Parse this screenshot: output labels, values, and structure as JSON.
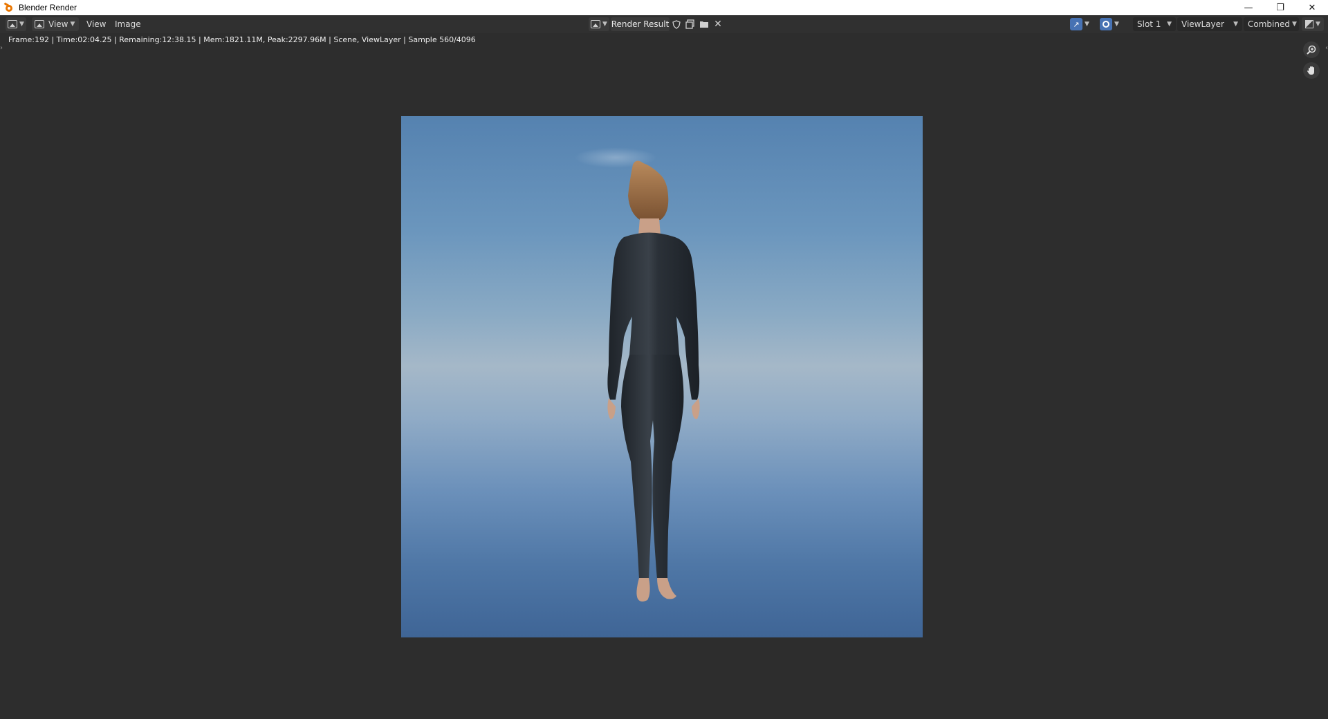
{
  "window": {
    "title": "Blender Render",
    "controls": {
      "minimize": "—",
      "maximize": "❐",
      "close": "✕"
    }
  },
  "header": {
    "editor_type_icon": "image-editor-icon",
    "mode": "View",
    "menus": [
      "View",
      "Image"
    ],
    "image_name": "Render Result",
    "icons": [
      "shield-icon",
      "new-image-icon",
      "open-folder-icon",
      "close-icon"
    ],
    "slot": "Slot 1",
    "view_layer": "ViewLayer",
    "pass": "Combined"
  },
  "status": {
    "text": "Frame:192 | Time:02:04.25 | Remaining:12:38.15 | Mem:1821.11M, Peak:2297.96M | Scene, ViewLayer | Sample 560/4096"
  },
  "navigation": {
    "zoom_icon": "zoom-icon",
    "pan_icon": "hand-pan-icon"
  },
  "colors": {
    "background": "#2d2d2d",
    "header": "#303030",
    "accent_blue": "#4772b3"
  }
}
